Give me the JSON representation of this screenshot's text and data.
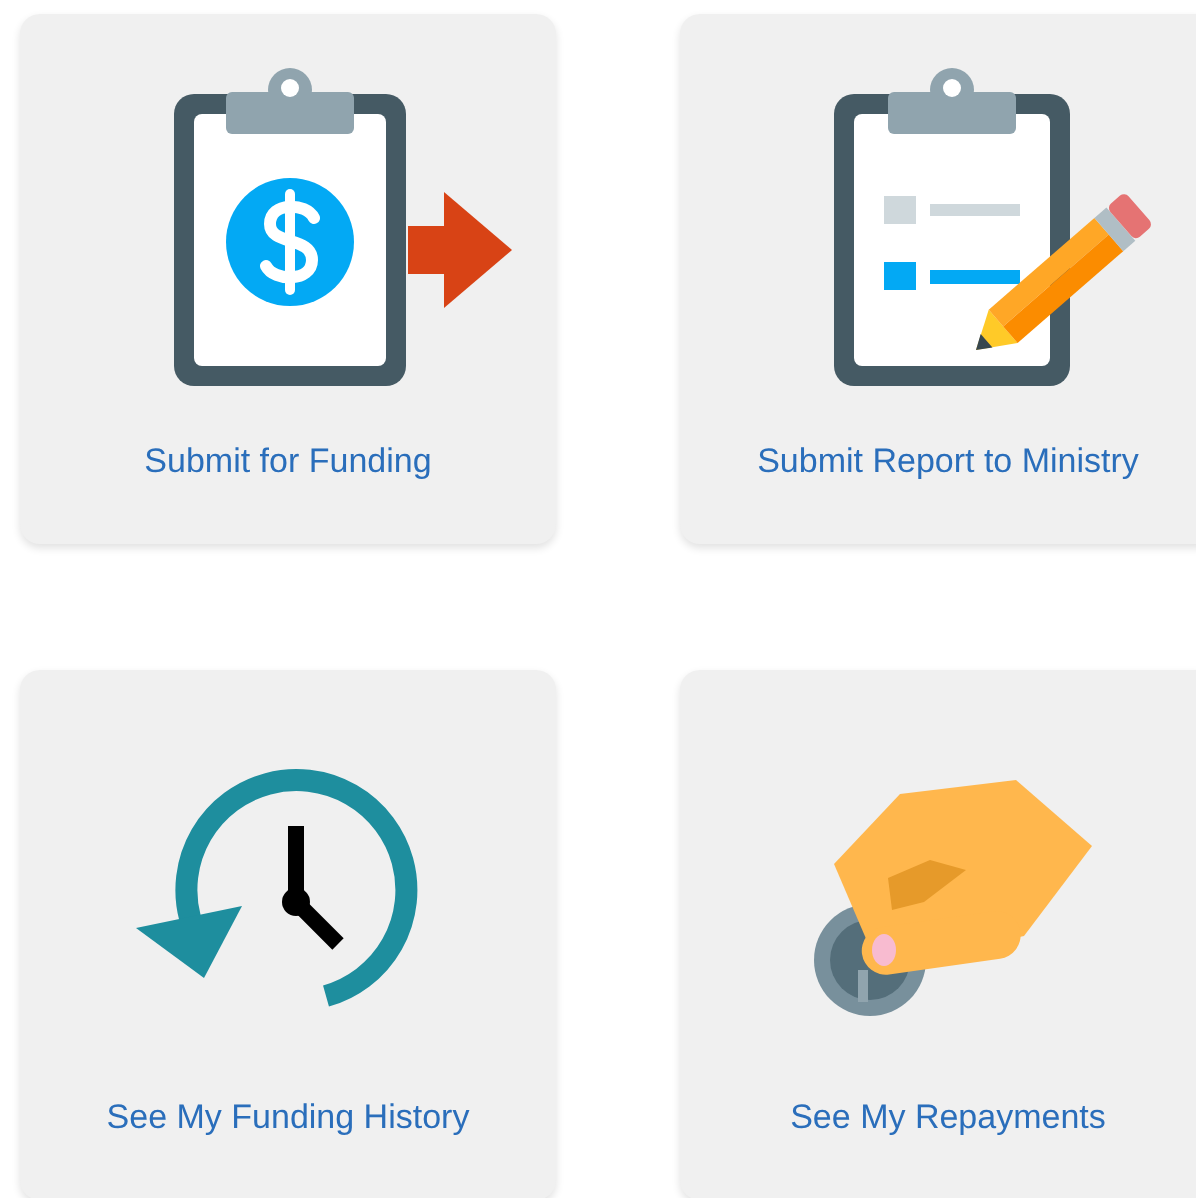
{
  "tiles": [
    {
      "kind": "clipboard-dollar",
      "label": "Submit for Funding"
    },
    {
      "kind": "clipboard-pencil",
      "label": "Submit Report to Ministry"
    },
    {
      "kind": "clock-history",
      "label": "See My Funding History"
    },
    {
      "kind": "hand-coin",
      "label": "See My Repayments"
    }
  ]
}
